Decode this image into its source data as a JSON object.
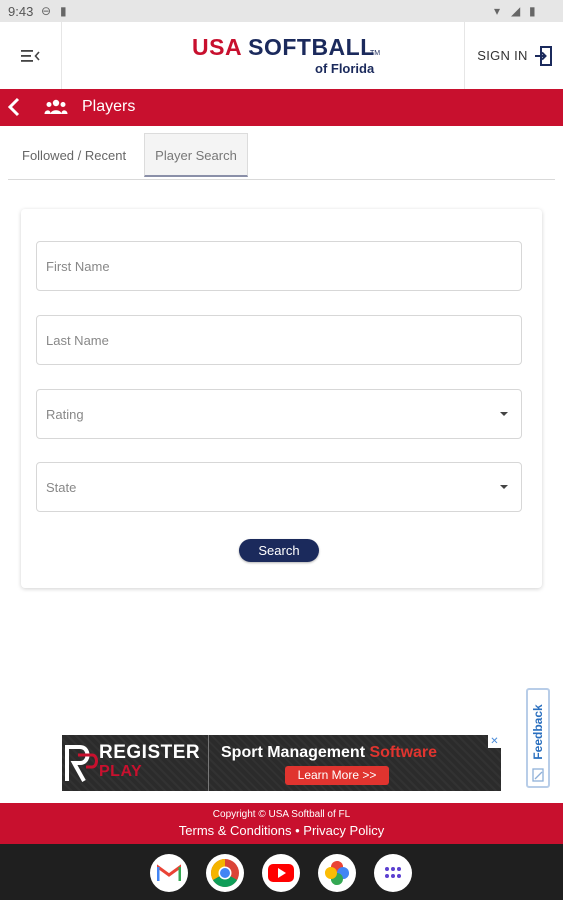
{
  "status_bar": {
    "time": "9:43"
  },
  "header": {
    "logo": {
      "line1_a": "USA",
      "line1_b": "SOFTBALL",
      "tm": "TM",
      "line2": "of Florida"
    },
    "sign_in": "SIGN IN"
  },
  "players_bar": {
    "title": "Players"
  },
  "tabs": [
    {
      "label": "Followed / Recent",
      "active": false
    },
    {
      "label": "Player Search",
      "active": true
    }
  ],
  "form": {
    "first_name": {
      "placeholder": "First Name",
      "value": ""
    },
    "last_name": {
      "placeholder": "Last Name",
      "value": ""
    },
    "rating": {
      "label": "Rating"
    },
    "state": {
      "label": "State"
    },
    "search_label": "Search"
  },
  "feedback": {
    "label": "Feedback"
  },
  "ad": {
    "brand_line1": "REGISTER",
    "brand_line2": "PLAY",
    "headline_a": "Sport Management",
    "headline_b": "Software",
    "cta": "Learn More >>",
    "close": "✕"
  },
  "footer": {
    "copyright": "Copyright © USA Softball of FL",
    "terms": "Terms & Conditions",
    "separator": "•",
    "privacy": "Privacy Policy"
  },
  "dock": [
    "gmail-icon",
    "chrome-icon",
    "youtube-icon",
    "photos-icon",
    "apps-icon"
  ],
  "colors": {
    "brand_red": "#c8102e",
    "brand_navy": "#1b2a5c"
  }
}
